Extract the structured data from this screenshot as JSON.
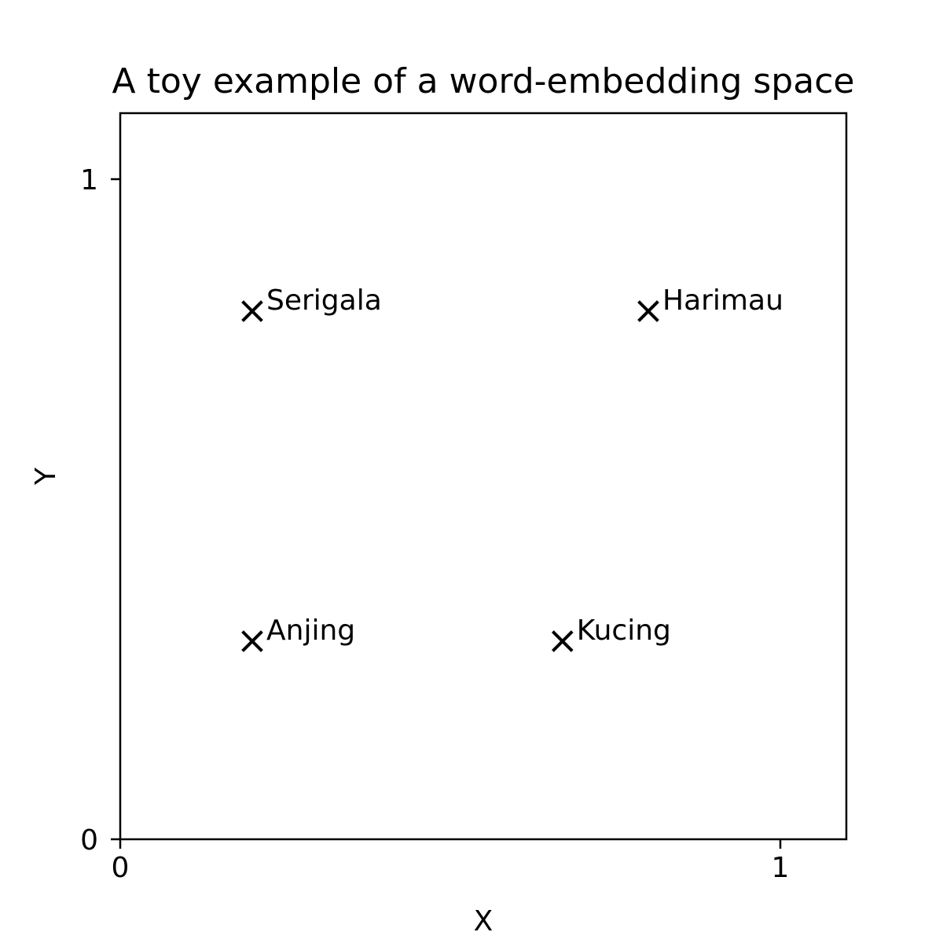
{
  "chart_data": {
    "type": "scatter",
    "title": "A toy example of a word-embedding space",
    "xlabel": "X",
    "ylabel": "Y",
    "xlim": [
      0,
      1.1
    ],
    "ylim": [
      -0.0,
      1.1
    ],
    "xticks": [
      {
        "value": 0,
        "label": "0"
      },
      {
        "value": 1,
        "label": "1"
      }
    ],
    "yticks": [
      {
        "value": 0,
        "label": "0"
      },
      {
        "value": 1,
        "label": "1"
      }
    ],
    "grid": false,
    "marker": "x",
    "marker_color": "#000000",
    "points": [
      {
        "label": "Serigala",
        "x": 0.2,
        "y": 0.8
      },
      {
        "label": "Harimau",
        "x": 0.8,
        "y": 0.8
      },
      {
        "label": "Anjing",
        "x": 0.2,
        "y": 0.3
      },
      {
        "label": "Kucing",
        "x": 0.67,
        "y": 0.3
      }
    ]
  }
}
